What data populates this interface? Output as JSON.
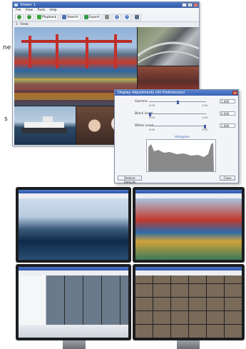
{
  "edge_labels": [
    "ne",
    "s"
  ],
  "app_window": {
    "title": "Viewer 1",
    "menu": [
      "File",
      "View",
      "Tools",
      "Help"
    ],
    "toolbar": [
      {
        "label": "",
        "icon": "back-icon"
      },
      {
        "label": "",
        "icon": "forward-icon"
      },
      {
        "label": "Playback",
        "icon": "play-icon"
      },
      {
        "label": "Search",
        "icon": "search-icon"
      },
      {
        "label": "Export",
        "icon": "export-icon"
      },
      {
        "label": "",
        "icon": "pointer-icon"
      },
      {
        "label": "",
        "icon": "zoom-in-icon"
      },
      {
        "label": "",
        "icon": "zoom-out-icon"
      },
      {
        "label": "",
        "icon": "layout-icon"
      }
    ],
    "view_label": "1 - Views"
  },
  "dialog": {
    "title": "Display Adjustments (All Preferences)",
    "sliders": [
      {
        "label": "Gamma",
        "min": "0.00",
        "max": "2.00",
        "value": "1.000",
        "level": 0.5
      },
      {
        "label": "Black Level",
        "min": "0.00",
        "max": "1.00",
        "value": "0.000",
        "level": 0.0
      },
      {
        "label": "White Level",
        "min": "0.00",
        "max": "1.00",
        "value": "1.000",
        "level": 1.0
      }
    ],
    "histogram_label": "Histogram",
    "buttons": {
      "left": "Restore Defaults",
      "right": "Close"
    }
  },
  "colors": {
    "accent": "#2f57a8",
    "dialog_bg": "#f3f4f7",
    "monitor_bezel": "#1c1d20"
  }
}
